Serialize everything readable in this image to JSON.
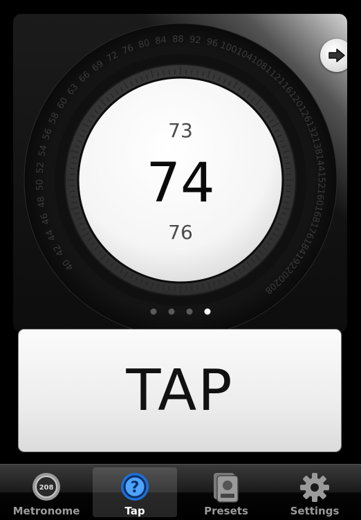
{
  "dial": {
    "prev_bpm": "73",
    "current_bpm": "74",
    "next_bpm": "76",
    "scale_labels": [
      "40",
      "42",
      "44",
      "46",
      "48",
      "50",
      "52",
      "54",
      "56",
      "58",
      "60",
      "63",
      "66",
      "69",
      "72",
      "76",
      "80",
      "84",
      "88",
      "92",
      "96",
      "100",
      "104",
      "108",
      "112",
      "116",
      "120",
      "126",
      "132",
      "138",
      "144",
      "152",
      "160",
      "168",
      "176",
      "184",
      "192",
      "200",
      "208"
    ],
    "page_dots": {
      "count": 4,
      "active": 4
    }
  },
  "forward_icon": "right-arrow-icon",
  "tap_button": {
    "label": "TAP"
  },
  "tab_bar": {
    "items": [
      {
        "label": "Metronome",
        "icon": "metronome-icon",
        "badge": "208"
      },
      {
        "label": "Tap",
        "icon": "question-icon",
        "badge": "?"
      },
      {
        "label": "Presets",
        "icon": "presets-icon"
      },
      {
        "label": "Settings",
        "icon": "gear-icon"
      }
    ],
    "active": "Tap"
  },
  "colors": {
    "accent_blue": "#1e6fd6",
    "background": "#000000"
  }
}
